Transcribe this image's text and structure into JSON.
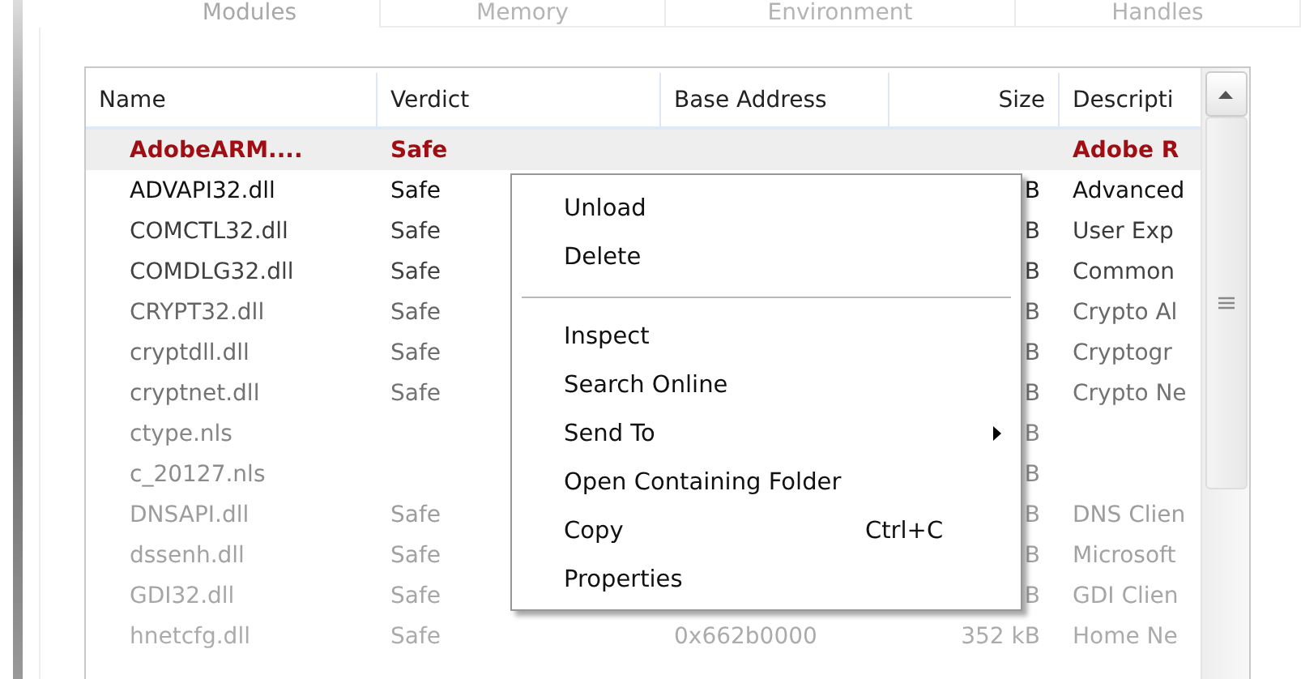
{
  "tabs": [
    {
      "label": "Modules",
      "selected": true
    },
    {
      "label": "Memory",
      "selected": false
    },
    {
      "label": "Environment",
      "selected": false
    },
    {
      "label": "Handles",
      "selected": false
    }
  ],
  "table": {
    "columns": [
      "Name",
      "Verdict",
      "Base Address",
      "Size",
      "Descripti"
    ],
    "rows": [
      {
        "selected": true,
        "cells": [
          "AdobeARM....",
          "Safe",
          "",
          "",
          "Adobe R"
        ]
      },
      {
        "selected": false,
        "cells": [
          "ADVAPI32.dll",
          "Safe",
          "",
          "B",
          "Advanced"
        ]
      },
      {
        "selected": false,
        "cells": [
          "COMCTL32.dll",
          "Safe",
          "",
          "B",
          "User Exp"
        ]
      },
      {
        "selected": false,
        "cells": [
          "COMDLG32.dll",
          "Safe",
          "",
          "B",
          "Common"
        ]
      },
      {
        "selected": false,
        "cells": [
          "CRYPT32.dll",
          "Safe",
          "",
          "B",
          "Crypto Al"
        ]
      },
      {
        "selected": false,
        "cells": [
          "cryptdll.dll",
          "Safe",
          "",
          "B",
          "Cryptogr"
        ]
      },
      {
        "selected": false,
        "cells": [
          "cryptnet.dll",
          "Safe",
          "",
          "B",
          "Crypto Ne"
        ]
      },
      {
        "selected": false,
        "cells": [
          "ctype.nls",
          "",
          "",
          "B",
          ""
        ]
      },
      {
        "selected": false,
        "cells": [
          "c_20127.nls",
          "",
          "",
          "B",
          ""
        ]
      },
      {
        "selected": false,
        "cells": [
          "DNSAPI.dll",
          "Safe",
          "",
          "B",
          "DNS Clien"
        ]
      },
      {
        "selected": false,
        "cells": [
          "dssenh.dll",
          "Safe",
          "",
          "B",
          "Microsoft"
        ]
      },
      {
        "selected": false,
        "cells": [
          "GDI32.dll",
          "Safe",
          "",
          "B",
          "GDI Clien"
        ]
      },
      {
        "selected": false,
        "cells": [
          "hnetcfg.dll",
          "Safe",
          "0x662b0000",
          "352 kB",
          "Home Ne"
        ]
      }
    ]
  },
  "context_menu": {
    "items": [
      {
        "kind": "item",
        "label": "Unload"
      },
      {
        "kind": "item",
        "label": "Delete"
      },
      {
        "kind": "separator"
      },
      {
        "kind": "item",
        "label": "Inspect"
      },
      {
        "kind": "item",
        "label": "Search Online"
      },
      {
        "kind": "submenu",
        "label": "Send To"
      },
      {
        "kind": "item",
        "label": "Open Containing Folder"
      },
      {
        "kind": "item",
        "label": "Copy",
        "shortcut": "Ctrl+C"
      },
      {
        "kind": "item",
        "label": "Properties"
      }
    ]
  }
}
